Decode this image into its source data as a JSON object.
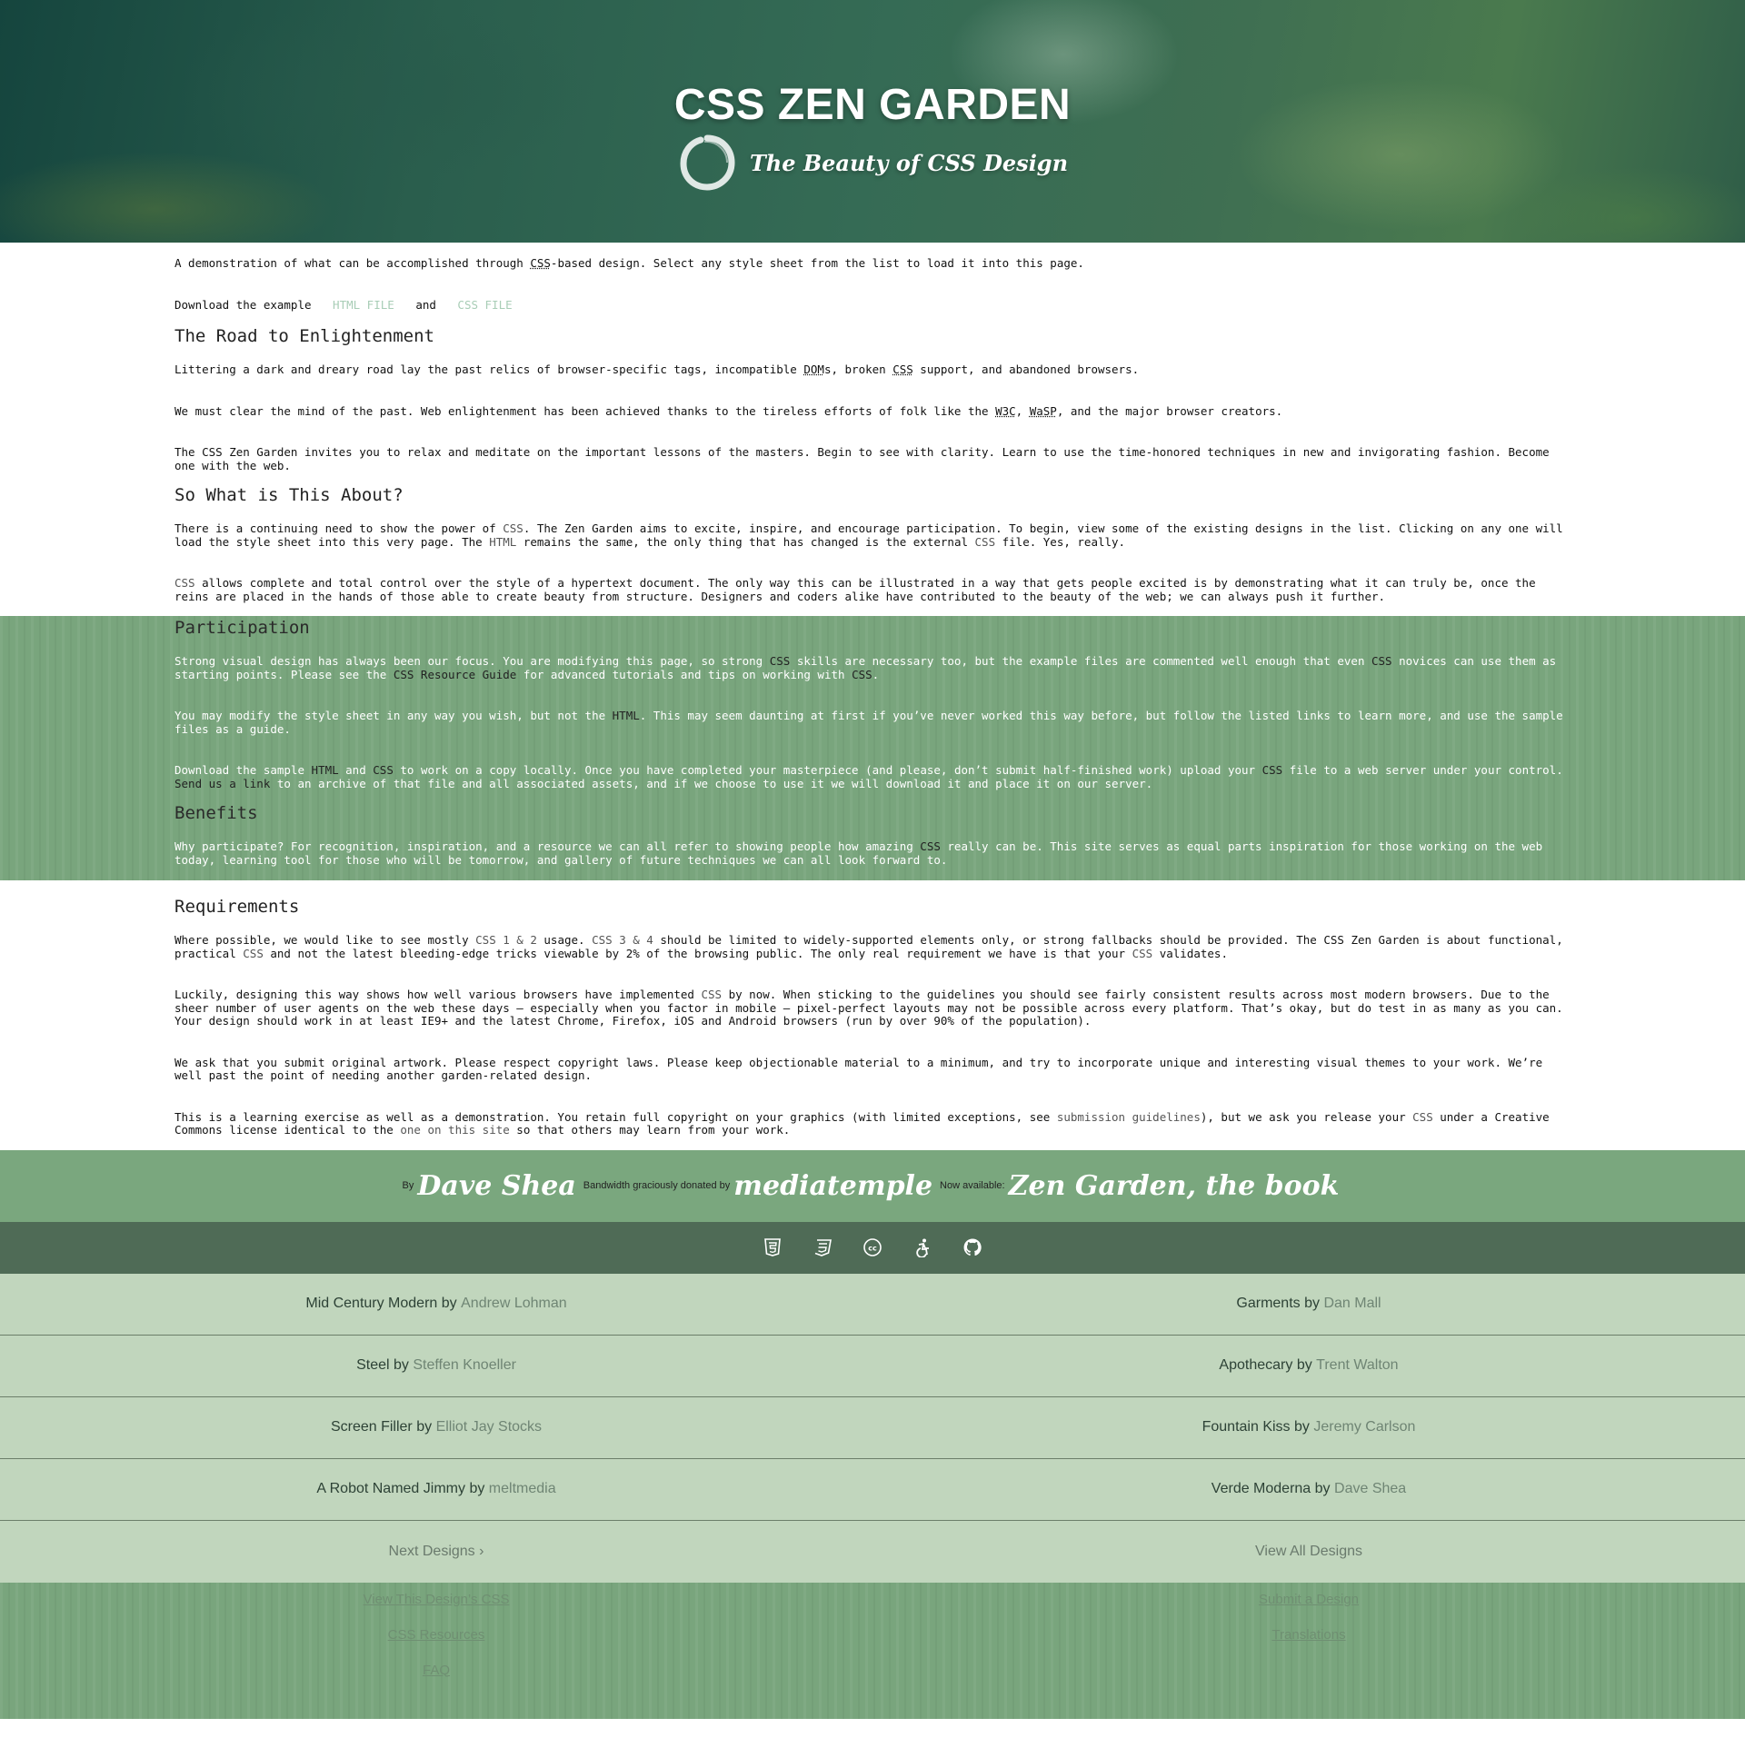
{
  "header": {
    "title": "CSS ZEN GARDEN",
    "tagline": "The Beauty of CSS Design"
  },
  "intro": {
    "p1_a": "A demonstration of what can be accomplished through ",
    "p1_abbr": "CSS",
    "p1_b": "-based design. Select any style sheet from the list to load it into this page.",
    "download_label": "Download the example",
    "html_file": "HTML FILE",
    "and": "and",
    "css_file": "CSS FILE"
  },
  "road": {
    "heading": "The Road to Enlightenment",
    "p1_a": "Littering a dark and dreary road lay the past relics of browser-specific tags, incompatible ",
    "p1_dom": "DOM",
    "p1_b": "s, broken ",
    "p1_css": "CSS",
    "p1_c": " support, and abandoned browsers.",
    "p2_a": "We must clear the mind of the past. Web enlightenment has been achieved thanks to the tireless efforts of folk like the ",
    "p2_w3c": "W3C",
    "p2_b": ", ",
    "p2_wasp": "WaSP",
    "p2_c": ", and the major browser creators.",
    "p3": "The CSS Zen Garden invites you to relax and meditate on the important lessons of the masters. Begin to see with clarity. Learn to use the time-honored techniques in new and invigorating fashion. Become one with the web."
  },
  "about": {
    "heading": "So What is This About?",
    "p1_a": "There is a continuing need to show the power of ",
    "p1_css": "CSS",
    "p1_b": ". The Zen Garden aims to excite, inspire, and encourage participation. To begin, view some of the existing designs in the list. Clicking on any one will load the style sheet into this very page. The ",
    "p1_html": "HTML",
    "p1_c": " remains the same, the only thing that has changed is the external ",
    "p1_css2": "CSS",
    "p1_d": " file. Yes, really.",
    "p2_css": "CSS",
    "p2_a": " allows complete and total control over the style of a hypertext document. The only way this can be illustrated in a way that gets people excited is by demonstrating what it can truly be, once the reins are placed in the hands of those able to create beauty from structure. Designers and coders alike have contributed to the beauty of the web; we can always push it further."
  },
  "participation": {
    "heading": "Participation",
    "p1_a": "Strong visual design has always been our focus. You are modifying this page, so strong ",
    "p1_css": "CSS",
    "p1_b": " skills are necessary too, but the example files are commented well enough that even ",
    "p1_css2": "CSS",
    "p1_c": " novices can use them as starting points. Please see the ",
    "p1_guide": "CSS Resource Guide",
    "p1_d": " for advanced tutorials and tips on working with ",
    "p1_css3": "CSS",
    "p1_e": ".",
    "p2_a": "You may modify the style sheet in any way you wish, but not the ",
    "p2_html": "HTML",
    "p2_b": ". This may seem daunting at first if you’ve never worked this way before, but follow the listed links to learn more, and use the sample files as a guide.",
    "p3_a": "Download the sample ",
    "p3_html": "HTML",
    "p3_b": " and ",
    "p3_css": "CSS",
    "p3_c": " to work on a copy locally. Once you have completed your masterpiece (and please, don’t submit half-finished work) upload your ",
    "p3_css2": "CSS",
    "p3_d": " file to a web server under your control. ",
    "p3_link": "Send us a link",
    "p3_e": " to an archive of that file and all associated assets, and if we choose to use it we will download it and place it on our server."
  },
  "benefits": {
    "heading": "Benefits",
    "p1_a": "Why participate? For recognition, inspiration, and a resource we can all refer to showing people how amazing ",
    "p1_css": "CSS",
    "p1_b": " really can be. This site serves as equal parts inspiration for those working on the web today, learning tool for those who will be tomorrow, and gallery of future techniques we can all look forward to."
  },
  "requirements": {
    "heading": "Requirements",
    "p1_a": "Where possible, we would like to see mostly ",
    "p1_css12": "CSS 1 & 2",
    "p1_b": " usage. ",
    "p1_css34": "CSS 3 & 4",
    "p1_c": " should be limited to widely-supported elements only, or strong fallbacks should be provided. The CSS Zen Garden is about functional, practical ",
    "p1_css": "CSS",
    "p1_d": " and not the latest bleeding-edge tricks viewable by 2% of the browsing public. The only real requirement we have is that your ",
    "p1_css2": "CSS",
    "p1_e": " validates.",
    "p2_a": "Luckily, designing this way shows how well various browsers have implemented ",
    "p2_css": "CSS",
    "p2_b": " by now. When sticking to the guidelines you should see fairly consistent results across most modern browsers. Due to the sheer number of user agents on the web these days — especially when you factor in mobile — pixel-perfect layouts may not be possible across every platform. That’s okay, but do test in as many as you can. Your design should work in at least IE9+ and the latest Chrome, Firefox, iOS and Android browsers (run by over 90% of the population).",
    "p3": "We ask that you submit original artwork. Please respect copyright laws. Please keep objectionable material to a minimum, and try to incorporate unique and interesting visual themes to your work. We’re well past the point of needing another garden-related design.",
    "p4_a": "This is a learning exercise as well as a demonstration. You retain full copyright on your graphics (with limited exceptions, see ",
    "p4_link": "submission guidelines",
    "p4_b": "), but we ask you release your ",
    "p4_css": "CSS",
    "p4_c": " under a Creative Commons license identical to the ",
    "p4_link2": "one on this site",
    "p4_d": " so that others may learn from your work."
  },
  "credit": {
    "by": "By",
    "author": "Dave Shea",
    "bandwidth": "Bandwidth graciously donated by",
    "host": "mediatemple",
    "now": "Now available:",
    "book": "Zen Garden, the book"
  },
  "icons": [
    "html5-icon",
    "css3-icon",
    "creative-commons-icon",
    "accessibility-icon",
    "github-icon"
  ],
  "designs": [
    {
      "title": "Mid Century Modern",
      "by": "by",
      "author": "Andrew Lohman"
    },
    {
      "title": "Garments",
      "by": "by",
      "author": "Dan Mall"
    },
    {
      "title": "Steel",
      "by": "by",
      "author": "Steffen Knoeller"
    },
    {
      "title": "Apothecary",
      "by": "by",
      "author": "Trent Walton"
    },
    {
      "title": "Screen Filler",
      "by": "by",
      "author": "Elliot Jay Stocks"
    },
    {
      "title": "Fountain Kiss",
      "by": "by",
      "author": "Jeremy Carlson"
    },
    {
      "title": "A Robot Named Jimmy",
      "by": "by",
      "author": "meltmedia"
    },
    {
      "title": "Verde Moderna",
      "by": "by",
      "author": "Dave Shea"
    }
  ],
  "nav": {
    "next": "Next Designs ›",
    "all": "View All Designs"
  },
  "extras": {
    "view_css": "View This Design’s CSS",
    "resources": "CSS Resources",
    "faq": "FAQ",
    "submit": "Submit a Design",
    "translations": "Translations"
  },
  "colors": {
    "green_band": "#79a57d",
    "dark_band": "#4f6b56",
    "list_bg": "#c1d6bd"
  }
}
